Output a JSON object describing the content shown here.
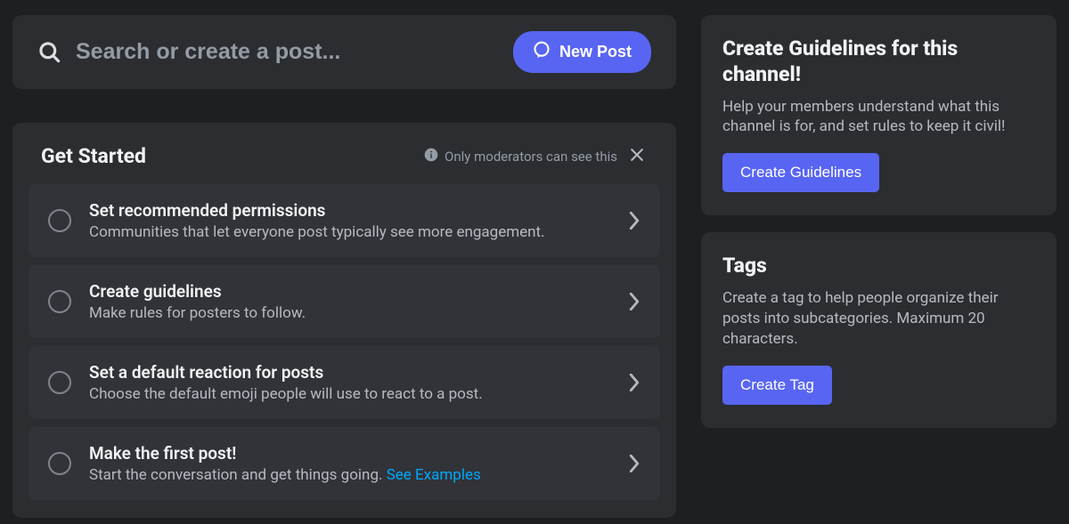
{
  "search": {
    "placeholder": "Search or create a post..."
  },
  "newPost": "New Post",
  "getStarted": {
    "title": "Get Started",
    "modNote": "Only moderators can see this",
    "items": [
      {
        "title": "Set recommended permissions",
        "desc": "Communities that let everyone post typically see more engagement."
      },
      {
        "title": "Create guidelines",
        "desc": "Make rules for posters to follow."
      },
      {
        "title": "Set a default reaction for posts",
        "desc": "Choose the default emoji people will use to react to a post."
      },
      {
        "title": "Make the first post!",
        "desc": "Start the conversation and get things going. ",
        "link": "See Examples"
      }
    ]
  },
  "guidelines": {
    "title": "Create Guidelines for this channel!",
    "desc": "Help your members understand what this channel is for, and set rules to keep it civil!",
    "button": "Create Guidelines"
  },
  "tags": {
    "title": "Tags",
    "desc": "Create a tag to help people organize their posts into subcategories. Maximum 20 characters.",
    "button": "Create Tag"
  }
}
